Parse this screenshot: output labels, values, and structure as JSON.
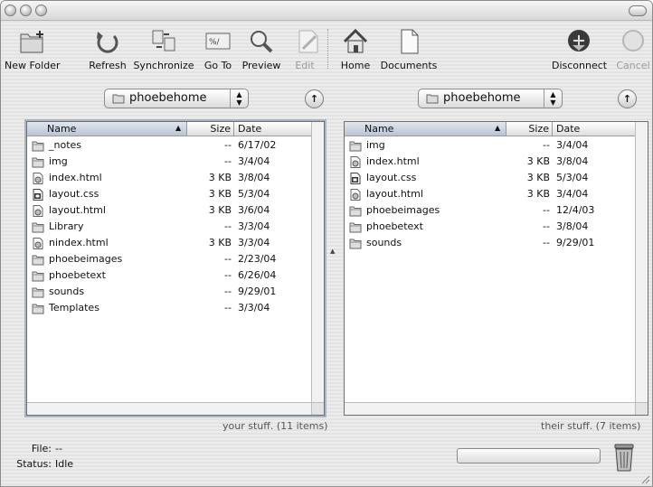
{
  "toolbar": {
    "new_folder": "New Folder",
    "refresh": "Refresh",
    "synchronize": "Synchronize",
    "go_to": "Go To",
    "preview": "Preview",
    "edit": "Edit",
    "home": "Home",
    "documents": "Documents",
    "disconnect": "Disconnect",
    "cancel": "Cancel"
  },
  "left": {
    "location": "phoebehome",
    "columns": {
      "name": "Name",
      "size": "Size",
      "date": "Date"
    },
    "files": [
      {
        "icon": "folder-icon",
        "name": "_notes",
        "size": "--",
        "date": "6/17/02"
      },
      {
        "icon": "folder-icon",
        "name": "img",
        "size": "--",
        "date": "3/4/04"
      },
      {
        "icon": "html-file-icon",
        "name": "index.html",
        "size": "3 KB",
        "date": "3/8/04"
      },
      {
        "icon": "css-file-icon",
        "name": "layout.css",
        "size": "3 KB",
        "date": "5/3/04"
      },
      {
        "icon": "html-file-icon",
        "name": "layout.html",
        "size": "3 KB",
        "date": "3/6/04"
      },
      {
        "icon": "folder-icon",
        "name": "Library",
        "size": "--",
        "date": "3/3/04"
      },
      {
        "icon": "html-file-icon",
        "name": "nindex.html",
        "size": "3 KB",
        "date": "3/3/04"
      },
      {
        "icon": "folder-icon",
        "name": "phoebeimages",
        "size": "--",
        "date": "2/23/04"
      },
      {
        "icon": "folder-icon",
        "name": "phoebetext",
        "size": "--",
        "date": "6/26/04"
      },
      {
        "icon": "folder-icon",
        "name": "sounds",
        "size": "--",
        "date": "9/29/01"
      },
      {
        "icon": "folder-icon",
        "name": "Templates",
        "size": "--",
        "date": "3/3/04"
      }
    ],
    "count": "your stuff. (11 items)"
  },
  "right": {
    "location": "phoebehome",
    "columns": {
      "name": "Name",
      "size": "Size",
      "date": "Date"
    },
    "files": [
      {
        "icon": "folder-icon",
        "name": "img",
        "size": "--",
        "date": "3/4/04"
      },
      {
        "icon": "html-file-icon",
        "name": "index.html",
        "size": "3 KB",
        "date": "3/8/04"
      },
      {
        "icon": "css-file-icon",
        "name": "layout.css",
        "size": "3 KB",
        "date": "5/3/04"
      },
      {
        "icon": "html-file-icon",
        "name": "layout.html",
        "size": "3 KB",
        "date": "3/4/04"
      },
      {
        "icon": "folder-icon",
        "name": "phoebeimages",
        "size": "--",
        "date": "12/4/03"
      },
      {
        "icon": "folder-icon",
        "name": "phoebetext",
        "size": "--",
        "date": "3/8/04"
      },
      {
        "icon": "folder-icon",
        "name": "sounds",
        "size": "--",
        "date": "9/29/01"
      }
    ],
    "count": "their stuff. (7 items)"
  },
  "status": {
    "file_label": "File:",
    "file_value": "--",
    "status_label": "Status:",
    "status_value": "Idle"
  }
}
